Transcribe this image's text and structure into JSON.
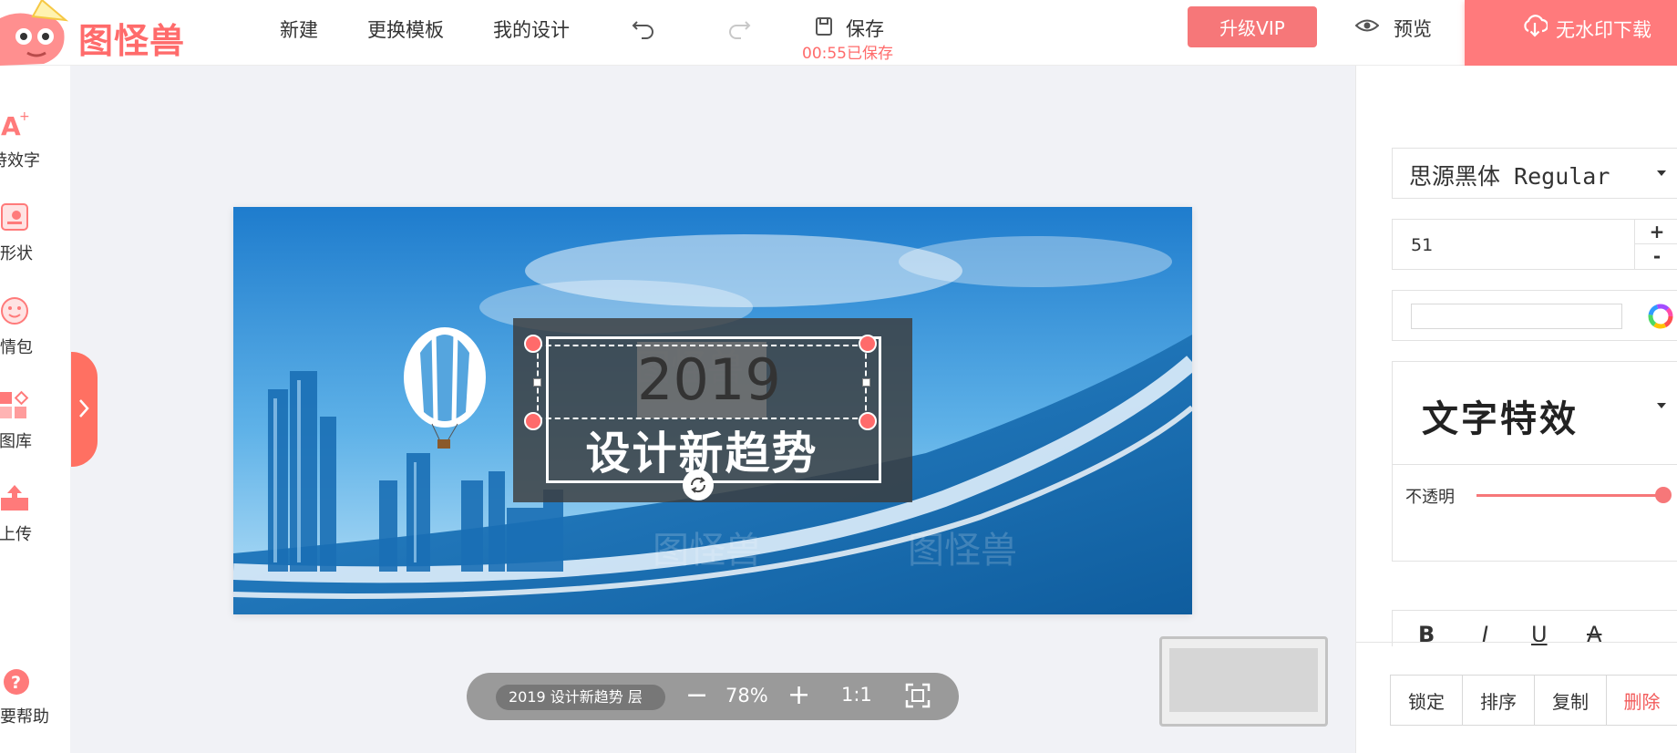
{
  "brand": {
    "name": "图怪兽"
  },
  "topnav": {
    "new": "新建",
    "change_template": "更换模板",
    "my_designs": "我的设计"
  },
  "save": {
    "label": "保存",
    "status": "00:55已保存"
  },
  "vip": {
    "label": "升级VIP"
  },
  "preview": {
    "label": "预览"
  },
  "download": {
    "label": "无水印下载"
  },
  "sidebar": {
    "items": [
      {
        "label": "特效字",
        "icon": "effect-text-icon"
      },
      {
        "label": "线条形状",
        "icon": "shape-icon"
      },
      {
        "label": "表情包",
        "icon": "emoji-icon"
      },
      {
        "label": "图库",
        "icon": "gallery-icon"
      },
      {
        "label": "上传",
        "icon": "upload-icon"
      }
    ],
    "help": "需要帮助"
  },
  "canvas": {
    "title_text": "2019",
    "subtitle_text": "设计新趋势",
    "watermark": "图怪兽"
  },
  "zoombar": {
    "layer": "2019 设计新趋势 层",
    "zoom": "78%",
    "ratio": "1:1",
    "minus": "−",
    "plus": "+"
  },
  "panel": {
    "font": "思源黑体 Regular",
    "size": "51",
    "size_plus": "+",
    "size_minus": "-",
    "effect": "文字特效",
    "opacity_label": "不透明",
    "opacity_value": 1.0,
    "format": {
      "bold": "B",
      "italic": "I",
      "underline": "U",
      "strike": "A"
    },
    "actions": {
      "lock": "锁定",
      "order": "排序",
      "copy": "复制",
      "delete": "删除"
    }
  },
  "colors": {
    "accent": "#f67779",
    "canvas_sky": "#2a8fd6"
  }
}
